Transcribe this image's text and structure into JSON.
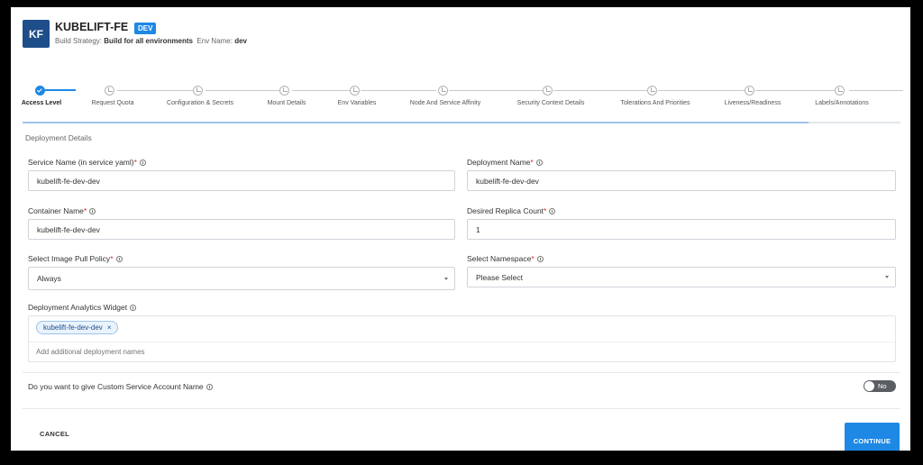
{
  "header": {
    "avatar_initials": "KF",
    "app_name": "KUBELIFT-FE",
    "env_badge": "DEV",
    "build_strategy_label": "Build Strategy:",
    "build_strategy_value": "Build for all environments",
    "env_name_label": "Env Name:",
    "env_name_value": "dev"
  },
  "stepper": {
    "steps": [
      {
        "label": "Access Level",
        "state": "completed"
      },
      {
        "label": "Request Quota",
        "state": "pending"
      },
      {
        "label": "Configuration & Secrets",
        "state": "pending"
      },
      {
        "label": "Mount Details",
        "state": "pending"
      },
      {
        "label": "Env Variables",
        "state": "pending"
      },
      {
        "label": "Node And Service Affinity",
        "state": "pending"
      },
      {
        "label": "Security Context Details",
        "state": "pending"
      },
      {
        "label": "Tolerations And Priorities",
        "state": "pending"
      },
      {
        "label": "Liveness/Readiness",
        "state": "pending"
      },
      {
        "label": "Labels/Annotations",
        "state": "pending"
      }
    ]
  },
  "section_title": "Deployment Details",
  "form": {
    "service_name": {
      "label": "Service Name (in service yaml)",
      "required": "*",
      "value": "kubelift-fe-dev-dev"
    },
    "deployment_name": {
      "label": "Deployment Name",
      "required": "*",
      "value": "kubelift-fe-dev-dev"
    },
    "container_name": {
      "label": "Container Name",
      "required": "*",
      "value": "kubelift-fe-dev-dev"
    },
    "replica_count": {
      "label": "Desired Replica Count",
      "required": "*",
      "value": "1"
    },
    "image_pull_policy": {
      "label": "Select Image Pull Policy",
      "required": "*",
      "value": "Always"
    },
    "namespace": {
      "label": "Select Namespace",
      "required": "*",
      "value": "Please Select"
    },
    "analytics_widget": {
      "label": "Deployment Analytics Widget",
      "chips": [
        "kubelift-fe-dev-dev"
      ],
      "chip_remove": "×",
      "placeholder": "Add additional deployment names"
    },
    "custom_service_account": {
      "question": "Do you want to give Custom Service Account Name",
      "toggle_label": "No"
    }
  },
  "actions": {
    "cancel": "CANCEL",
    "continue": "CONTINUE"
  },
  "colors": {
    "primary": "#1e88e5",
    "avatar_bg": "#1d4e89",
    "required": "#d32f2f"
  }
}
